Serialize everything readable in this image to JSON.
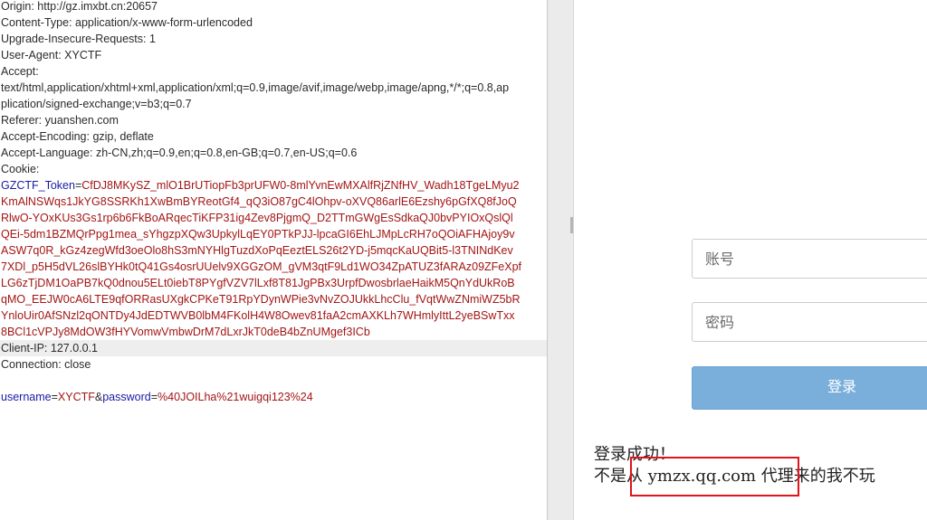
{
  "request": {
    "headers": {
      "origin": "Origin: http://gz.imxbt.cn:20657",
      "content_type": "Content-Type: application/x-www-form-urlencoded",
      "upgrade_insecure": "Upgrade-Insecure-Requests: 1",
      "user_agent": "User-Agent: XYCTF",
      "accept_label": "Accept:",
      "accept_value_1": "text/html,application/xhtml+xml,application/xml;q=0.9,image/avif,image/webp,image/apng,*/*;q=0.8,ap",
      "accept_value_2": "plication/signed-exchange;v=b3;q=0.7",
      "referer": "Referer: yuanshen.com",
      "accept_encoding": "Accept-Encoding: gzip, deflate",
      "accept_language": "Accept-Language: zh-CN,zh;q=0.9,en;q=0.8,en-GB;q=0.7,en-US;q=0.6",
      "cookie_label": "Cookie:",
      "client_ip": "Client-IP: 127.0.0.1",
      "connection": "Connection: close"
    },
    "cookie": {
      "name": "GZCTF_Token",
      "eq": "=",
      "value_lines": [
        "CfDJ8MKySZ_mlO1BrUTiopFb3prUFW0-8mlYvnEwMXAlfRjZNfHV_Wadh18TgeLMyu2",
        "KmAlNSWqs1JkYG8SSRKh1XwBmBYReotGf4_qQ3iO87gC4lOhpv-oXVQ86arlE6Ezshy6pGfXQ8fJoQ",
        "RlwO-YOxKUs3Gs1rp6b6FkBoARqecTiKFP31ig4Zev8PjgmQ_D2TTmGWgEsSdkaQJ0bvPYIOxQslQl",
        "QEi-5dm1BZMQrPpg1mea_sYhgzpXQw3UpkylLqEY0PTkPJJ-lpcaGI6EhLJMpLcRH7oQOiAFHAjoy9v",
        "ASW7q0R_kGz4zegWfd3oeOlo8hS3mNYHlgTuzdXoPqEeztELS26t2YD-j5mqcKaUQBit5-l3TNINdKev",
        "7XDl_p5H5dVL26slBYHk0tQ41Gs4osrUUelv9XGGzOM_gVM3qtF9Ld1WO34ZpATUZ3fARAz09ZFeXpf",
        "LG6zTjDM1OaPB7kQ0dnou5ELt0iebT8PYgfVZV7lLxf8T81JgPBx3UrpfDwosbrlaeHaikM5QnYdUkRoB",
        "qMO_EEJW0cA6LTE9qfORRasUXgkCPKeT91RpYDynWPie3vNvZOJUkkLhcClu_fVqtWwZNmiWZ5bR",
        "YnloUir0AfSNzl2qONTDy4JdEDTWVB0lbM4FKolH4W8Owev81faA2cmAXKLh7WHmlyIttL2yeBSwTxx",
        "8BCl1cVPJy8MdOW3fHYVomwVmbwDrM7dLxrJkT0deB4bZnUMgef3ICb"
      ]
    },
    "body": {
      "username_key": "username",
      "username_value": "XYCTF",
      "amp": "&",
      "password_key": "password",
      "password_value": "%40JOILha%21wuigqi123%24"
    }
  },
  "response": {
    "username_placeholder": "账号",
    "password_placeholder": "密码",
    "login_label": "登录",
    "success_text": "登录成功！",
    "message_text": "不是从 ymzx.qq.com 代理来的我不玩"
  }
}
